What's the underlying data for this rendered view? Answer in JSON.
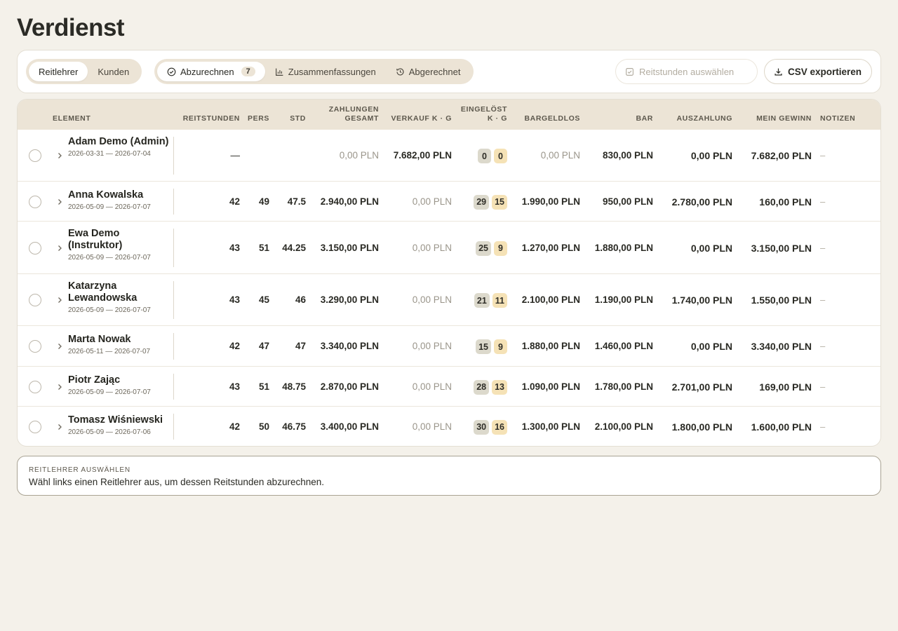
{
  "page": {
    "title": "Verdienst"
  },
  "toolbar": {
    "role_tabs": [
      {
        "label": "Reitlehrer",
        "active": true
      },
      {
        "label": "Kunden",
        "active": false
      }
    ],
    "status_tabs": [
      {
        "label": "Abzurechnen",
        "count": "7",
        "icon": "check-circle-icon",
        "active": true
      },
      {
        "label": "Zusammenfassungen",
        "icon": "bar-chart-icon",
        "active": false
      },
      {
        "label": "Abgerechnet",
        "icon": "history-icon",
        "active": false
      }
    ],
    "select_label": "Reitstunden auswählen",
    "export_label": "CSV exportieren"
  },
  "table": {
    "headers": {
      "element": "Element",
      "reitstunden": "Reitstunden",
      "pers": "Pers",
      "std": "Std",
      "zahlungen_1": "Zahlungen",
      "zahlungen_2": "gesamt",
      "verkauf": "Verkauf K · G",
      "eingeloest_1": "Eingelöst",
      "eingeloest_2": "K · G",
      "bargeldlos": "Bargeldlos",
      "bar": "Bar",
      "auszahlung": "Auszahlung",
      "gewinn": "Mein Gewinn",
      "notizen": "Notizen"
    },
    "rows": [
      {
        "name": "Adam Demo (Admin)",
        "dates": "2026-03-31 — 2026-07-04",
        "reitstunden": "—",
        "pers": "",
        "std": "",
        "zahlungen": "0,00 PLN",
        "verkauf": "7.682,00 PLN",
        "k": "0",
        "g": "0",
        "bargeldlos": "0,00 PLN",
        "bar": "830,00 PLN",
        "auszahlung": "0,00 PLN",
        "gewinn": "7.682,00 PLN",
        "notiz": "–"
      },
      {
        "name": "Anna Kowalska",
        "dates": "2026-05-09 — 2026-07-07",
        "reitstunden": "42",
        "pers": "49",
        "std": "47.5",
        "zahlungen": "2.940,00 PLN",
        "verkauf": "0,00 PLN",
        "k": "29",
        "g": "15",
        "bargeldlos": "1.990,00 PLN",
        "bar": "950,00 PLN",
        "auszahlung": "2.780,00 PLN",
        "gewinn": "160,00 PLN",
        "notiz": "–"
      },
      {
        "name": "Ewa Demo (Instruktor)",
        "dates": "2026-05-09 — 2026-07-07",
        "reitstunden": "43",
        "pers": "51",
        "std": "44.25",
        "zahlungen": "3.150,00 PLN",
        "verkauf": "0,00 PLN",
        "k": "25",
        "g": "9",
        "bargeldlos": "1.270,00 PLN",
        "bar": "1.880,00 PLN",
        "auszahlung": "0,00 PLN",
        "gewinn": "3.150,00 PLN",
        "notiz": "–"
      },
      {
        "name": "Katarzyna Lewandowska",
        "dates": "2026-05-09 — 2026-07-07",
        "reitstunden": "43",
        "pers": "45",
        "std": "46",
        "zahlungen": "3.290,00 PLN",
        "verkauf": "0,00 PLN",
        "k": "21",
        "g": "11",
        "bargeldlos": "2.100,00 PLN",
        "bar": "1.190,00 PLN",
        "auszahlung": "1.740,00 PLN",
        "gewinn": "1.550,00 PLN",
        "notiz": "–"
      },
      {
        "name": "Marta Nowak",
        "dates": "2026-05-11 — 2026-07-07",
        "reitstunden": "42",
        "pers": "47",
        "std": "47",
        "zahlungen": "3.340,00 PLN",
        "verkauf": "0,00 PLN",
        "k": "15",
        "g": "9",
        "bargeldlos": "1.880,00 PLN",
        "bar": "1.460,00 PLN",
        "auszahlung": "0,00 PLN",
        "gewinn": "3.340,00 PLN",
        "notiz": "–"
      },
      {
        "name": "Piotr Zając",
        "dates": "2026-05-09 — 2026-07-07",
        "reitstunden": "43",
        "pers": "51",
        "std": "48.75",
        "zahlungen": "2.870,00 PLN",
        "verkauf": "0,00 PLN",
        "k": "28",
        "g": "13",
        "bargeldlos": "1.090,00 PLN",
        "bar": "1.780,00 PLN",
        "auszahlung": "2.701,00 PLN",
        "gewinn": "169,00 PLN",
        "notiz": "–"
      },
      {
        "name": "Tomasz Wiśniewski",
        "dates": "2026-05-09 — 2026-07-06",
        "reitstunden": "42",
        "pers": "50",
        "std": "46.75",
        "zahlungen": "3.400,00 PLN",
        "verkauf": "0,00 PLN",
        "k": "30",
        "g": "16",
        "bargeldlos": "1.300,00 PLN",
        "bar": "2.100,00 PLN",
        "auszahlung": "1.800,00 PLN",
        "gewinn": "1.600,00 PLN",
        "notiz": "–"
      }
    ]
  },
  "info": {
    "title": "Reitlehrer auswählen",
    "text": "Wähl links einen Reitlehrer aus, um dessen Reitstunden abzurechnen."
  }
}
